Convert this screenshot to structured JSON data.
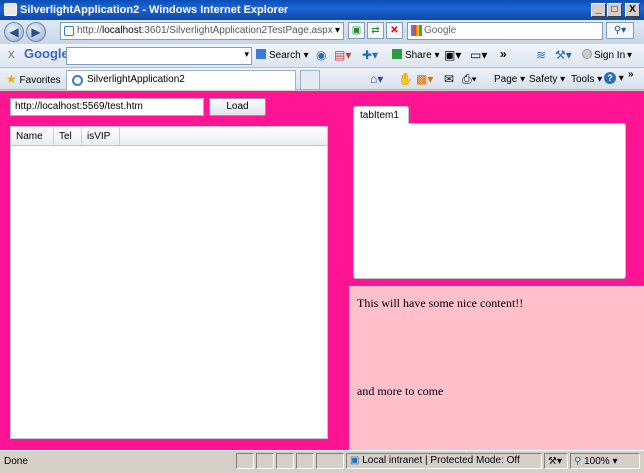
{
  "window": {
    "title": "SilverlightApplication2 - Windows Internet Explorer",
    "minimize": "_",
    "maximize": "□",
    "close": "X"
  },
  "address_bar": {
    "url_prefix": "http://",
    "url_host": "localhost",
    "url_rest": ":3601/SilverlightApplication2TestPage.aspx",
    "search_placeholder": "Google"
  },
  "google_toolbar": {
    "close": "X",
    "logo": "Google",
    "search_label": "Search",
    "share_label": "Share",
    "more": "»",
    "signin_label": "Sign In"
  },
  "favorites_bar": {
    "favorites_label": "Favorites",
    "tab_label": "SilverlightApplication2",
    "page_label": "Page",
    "safety_label": "Safety",
    "tools_label": "Tools",
    "help_label": "?",
    "more": "»"
  },
  "app": {
    "url_input_value": "http://localhost:5569/test.htm",
    "load_button": "Load",
    "grid_columns": [
      "Name",
      "Tel",
      "isVIP"
    ],
    "tab_header": "tabItem1",
    "content_line1": "This will have some nice content!!",
    "content_line2": "and more to come"
  },
  "status_bar": {
    "status": "Done",
    "zone": "Local intranet | Protected Mode: Off",
    "zoom": "100%"
  },
  "colors": {
    "page_background": "#ff1493",
    "panel_background": "#ffc0cb"
  }
}
